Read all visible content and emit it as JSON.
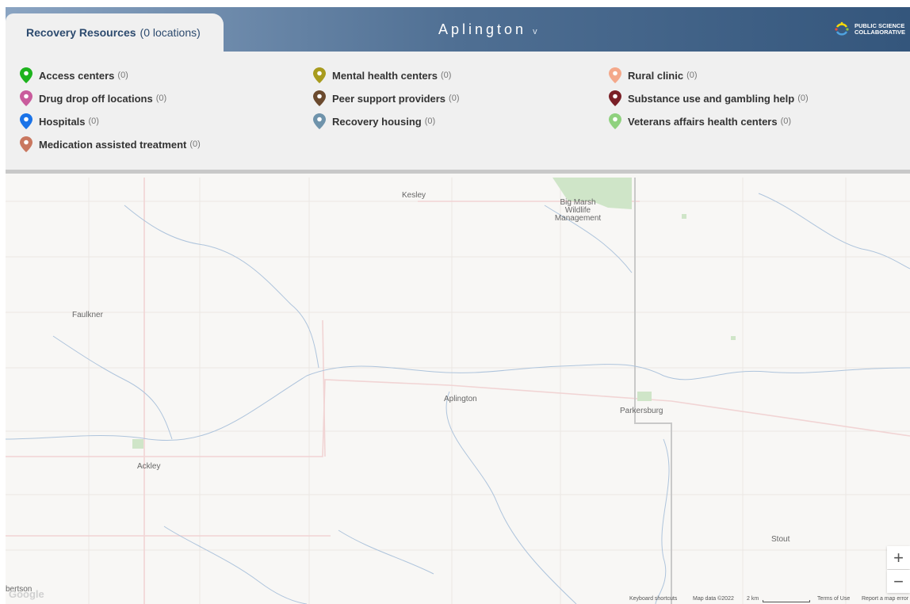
{
  "header": {
    "tab_title": "Recovery Resources",
    "tab_count": "(0 locations)",
    "town": "Aplington",
    "caret": "v",
    "logo_line1": "PUBLIC SCIENCE",
    "logo_line2": "COLLABORATIVE"
  },
  "legend": {
    "items": [
      {
        "label": "Access centers",
        "count": "(0)",
        "color": "#1db31d"
      },
      {
        "label": "Drug drop off locations",
        "count": "(0)",
        "color": "#c95b9c"
      },
      {
        "label": "Hospitals",
        "count": "(0)",
        "color": "#1a73e8"
      },
      {
        "label": "Medication assisted treatment",
        "count": "(0)",
        "color": "#c9775f"
      },
      {
        "label": "Mental health centers",
        "count": "(0)",
        "color": "#a89b1e"
      },
      {
        "label": "Peer support providers",
        "count": "(0)",
        "color": "#6b4a2e"
      },
      {
        "label": "Recovery housing",
        "count": "(0)",
        "color": "#6f93ab"
      },
      {
        "label": "Rural clinic",
        "count": "(0)",
        "color": "#f4a88a"
      },
      {
        "label": "Substance use and gambling help",
        "count": "(0)",
        "color": "#7a1f26"
      },
      {
        "label": "Veterans affairs health centers",
        "count": "(0)",
        "color": "#8fd17e"
      }
    ]
  },
  "map": {
    "places": {
      "kesley": "Kesley",
      "big_marsh": "Big Marsh\nWildlife\nManagement",
      "faulkner": "Faulkner",
      "aplington": "Aplington",
      "parkersburg": "Parkersburg",
      "ackley": "Ackley",
      "stout": "Stout",
      "robertson": "bertson"
    },
    "zoom_in": "+",
    "zoom_out": "−",
    "google": "Google",
    "attribution": {
      "shortcuts": "Keyboard shortcuts",
      "map_data": "Map data ©2022",
      "scale": "2 km",
      "terms": "Terms of Use",
      "report": "Report a map error"
    }
  }
}
